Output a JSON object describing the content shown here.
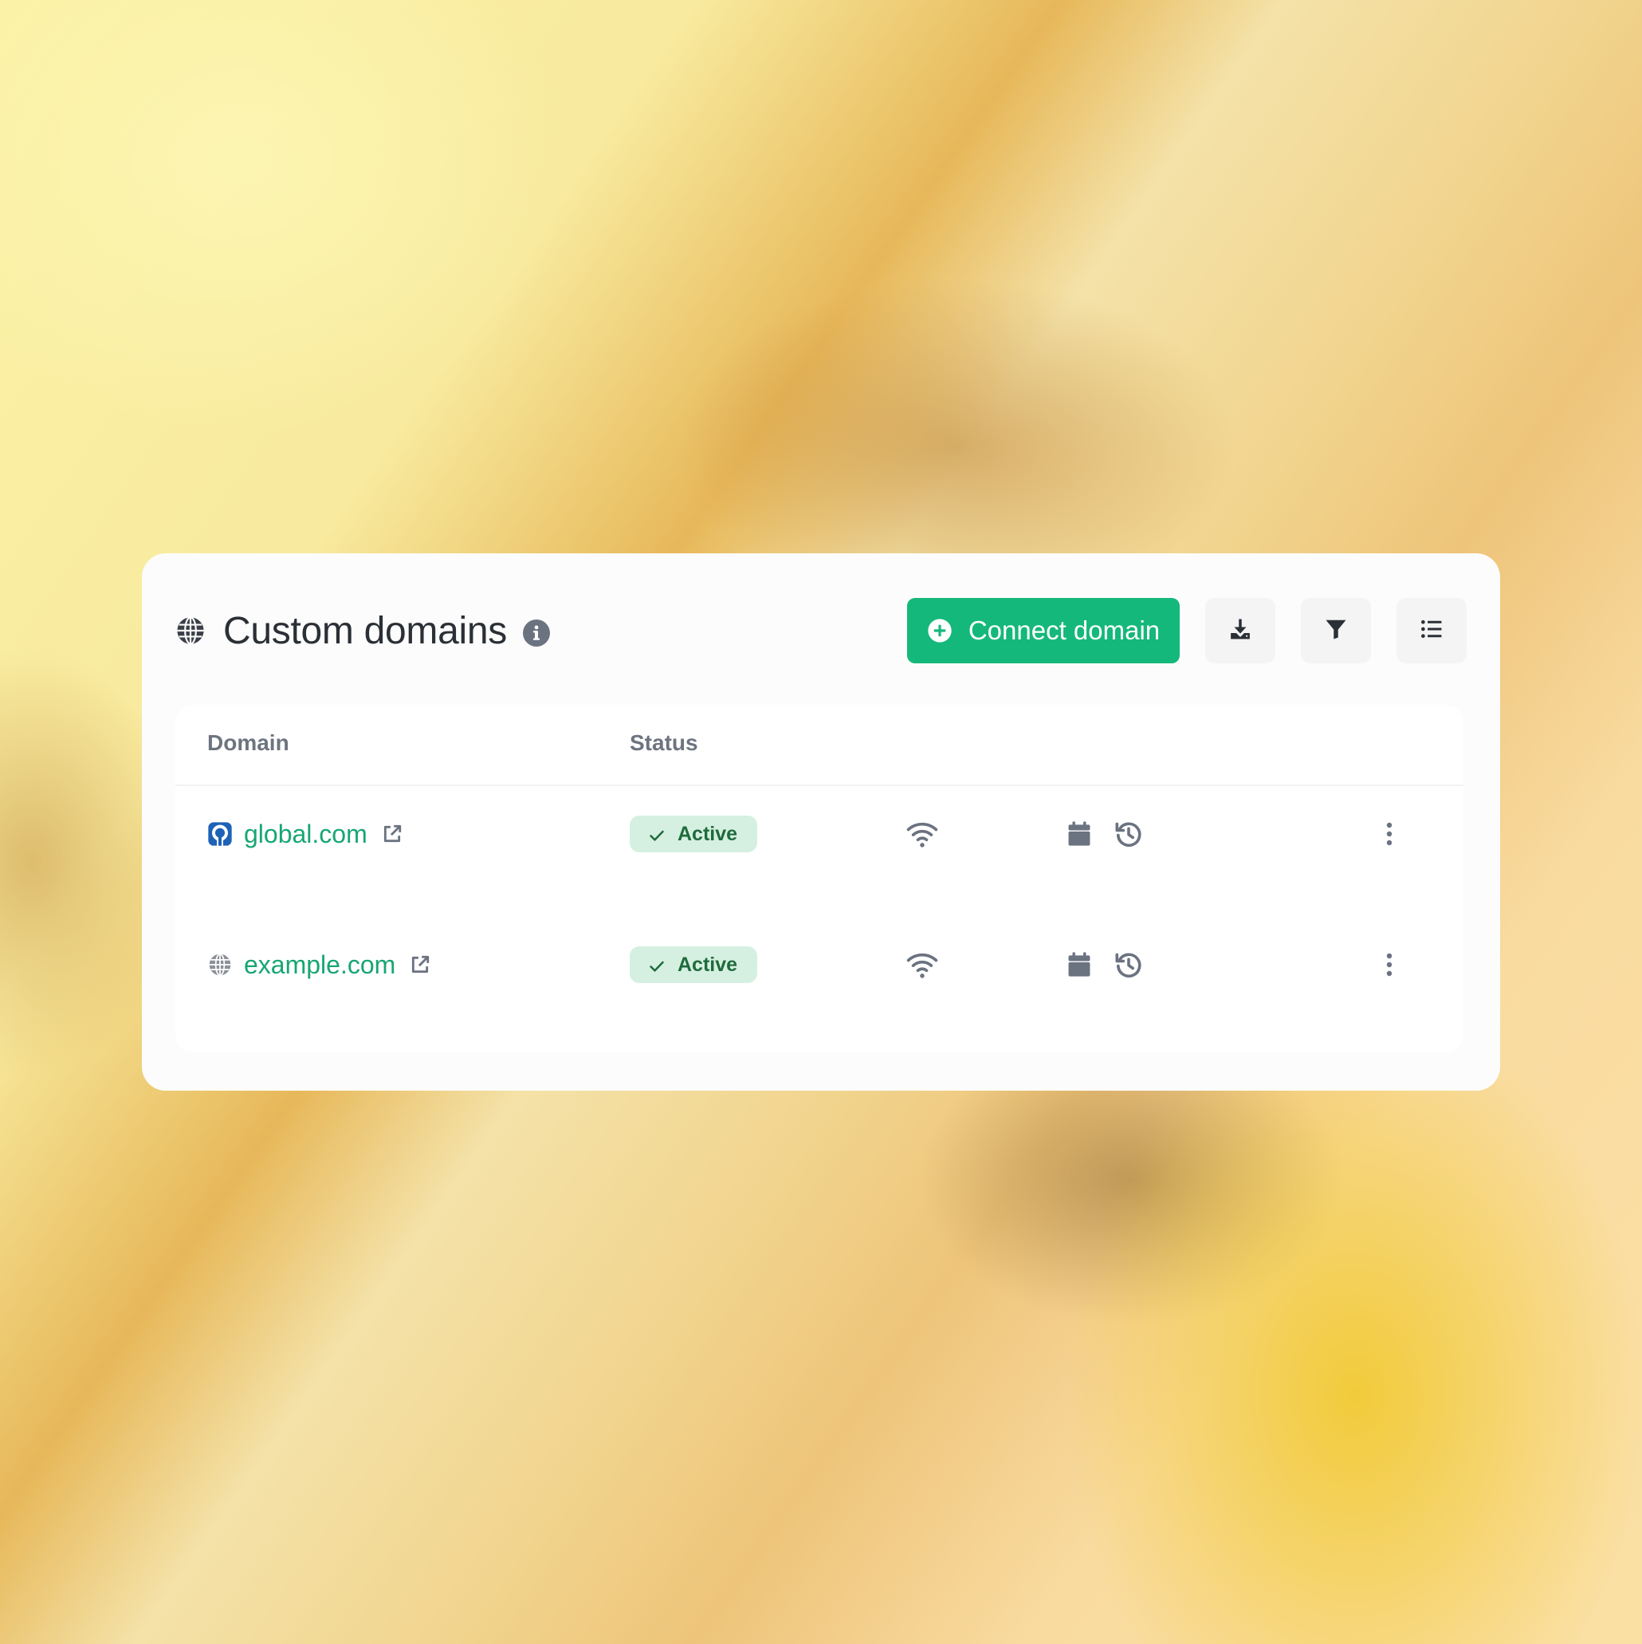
{
  "header": {
    "title": "Custom domains",
    "title_icon": "globe-icon",
    "info_icon": "info-icon"
  },
  "actions": {
    "connect_label": "Connect domain",
    "connect_icon": "plus-circle-icon",
    "download_icon": "download-icon",
    "filter_icon": "filter-icon",
    "list_icon": "list-icon"
  },
  "table": {
    "columns": [
      "Domain",
      "Status"
    ],
    "rows": [
      {
        "domain": "global.com",
        "favicon": "brand-favicon-icon",
        "status": "Active",
        "icons": [
          "wifi-icon",
          "calendar-icon",
          "history-icon",
          "more-vertical-icon"
        ]
      },
      {
        "domain": "example.com",
        "favicon": "globe-icon",
        "status": "Active",
        "icons": [
          "wifi-icon",
          "calendar-icon",
          "history-icon",
          "more-vertical-icon"
        ]
      }
    ]
  },
  "colors": {
    "accent": "#14b87b",
    "link": "#17a673",
    "badge_bg": "#d5f0e0",
    "badge_text": "#1f6b3c",
    "icon_gray": "#6b7280"
  }
}
